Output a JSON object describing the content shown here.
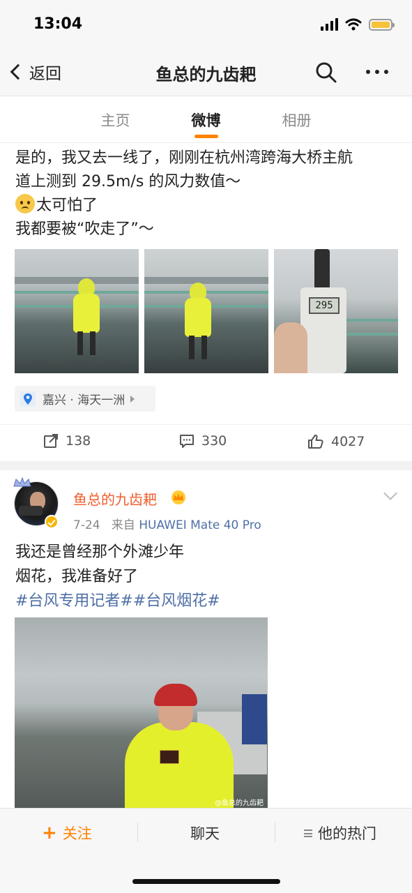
{
  "status_bar": {
    "time": "13:04"
  },
  "nav": {
    "back_label": "返回",
    "title": "鱼总的九齿耙"
  },
  "tabs": [
    {
      "label": "主页",
      "active": false
    },
    {
      "label": "微博",
      "active": true
    },
    {
      "label": "相册",
      "active": false
    }
  ],
  "post1": {
    "lines": [
      "是的，我又去一线了，刚刚在杭州湾跨海大桥主航",
      "道上测到 29.5m/s 的风力数值～",
      "太可怕了",
      "我都要被“吹走了”～"
    ],
    "meter_reading": "295",
    "location": "嘉兴 · 海天一洲",
    "reposts": "138",
    "comments": "330",
    "likes": "4027"
  },
  "post2": {
    "user_name": "鱼总的九齿耙",
    "date": "7-24",
    "from_label": "来自",
    "source": "HUAWEI Mate 40 Pro",
    "line1": "我还是曾经那个外滩少年",
    "line2": "烟花，我准备好了",
    "hashtags": "#台风专用记者##台风烟花#",
    "watermark": "@鱼总的九齿耙"
  },
  "bottom_bar": {
    "follow": "关注",
    "chat": "聊天",
    "hot": "他的热门"
  },
  "colors": {
    "accent": "#ff8200",
    "link": "#4f6fa6",
    "username": "#f15d2b"
  },
  "icons": [
    "back-chevron-icon",
    "search-icon",
    "more-icon",
    "location-pin-icon",
    "repost-icon",
    "comment-icon",
    "like-icon",
    "verified-icon",
    "vip-crown-icon",
    "chevron-down-icon",
    "plus-icon",
    "list-icon"
  ]
}
